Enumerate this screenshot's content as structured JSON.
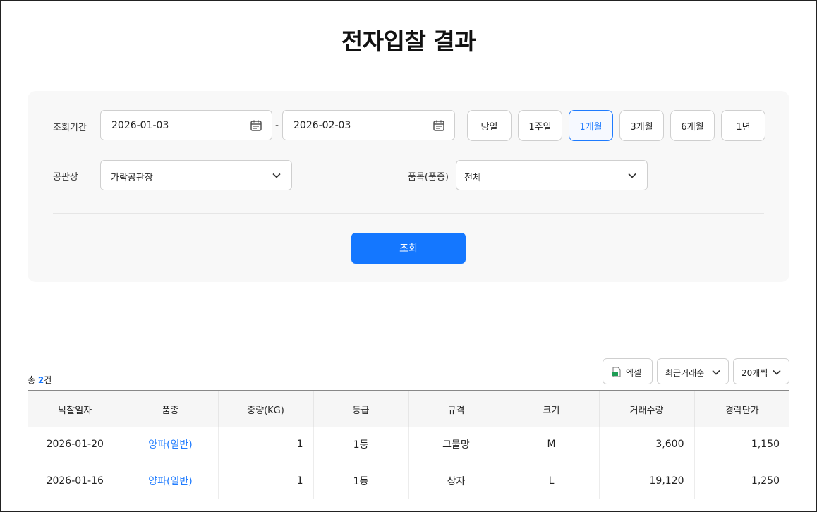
{
  "page": {
    "title": "전자입찰 결과"
  },
  "search": {
    "period_label": "조회기간",
    "start_date": "2026-01-03",
    "end_date": "2026-02-03",
    "separator": "-",
    "period_buttons": [
      "당일",
      "1주일",
      "1개월",
      "3개월",
      "6개월",
      "1년"
    ],
    "active_period": "1개월",
    "market_label": "공판장",
    "market_value": "가락공판장",
    "item_label": "품목(품종)",
    "item_value": "전체",
    "submit_label": "조회"
  },
  "results": {
    "total_prefix": "총 ",
    "total_count": "2",
    "total_suffix": "건",
    "excel_label": "엑셀",
    "sort_value": "최근거래순",
    "page_size_value": "20개씩",
    "columns": [
      "낙찰일자",
      "품종",
      "중량(KG)",
      "등급",
      "규격",
      "크기",
      "거래수량",
      "경락단가"
    ],
    "rows": [
      [
        "2026-01-20",
        "양파(일반)",
        "1",
        "1등",
        "그물망",
        "M",
        "3,600",
        "1,150"
      ],
      [
        "2026-01-16",
        "양파(일반)",
        "1",
        "1등",
        "상자",
        "L",
        "19,120",
        "1,250"
      ]
    ]
  },
  "colors": {
    "accent": "#1477ff",
    "link": "#1e7bff",
    "panel_bg": "#f8f8f8",
    "excel_icon": "#1f9d55"
  }
}
